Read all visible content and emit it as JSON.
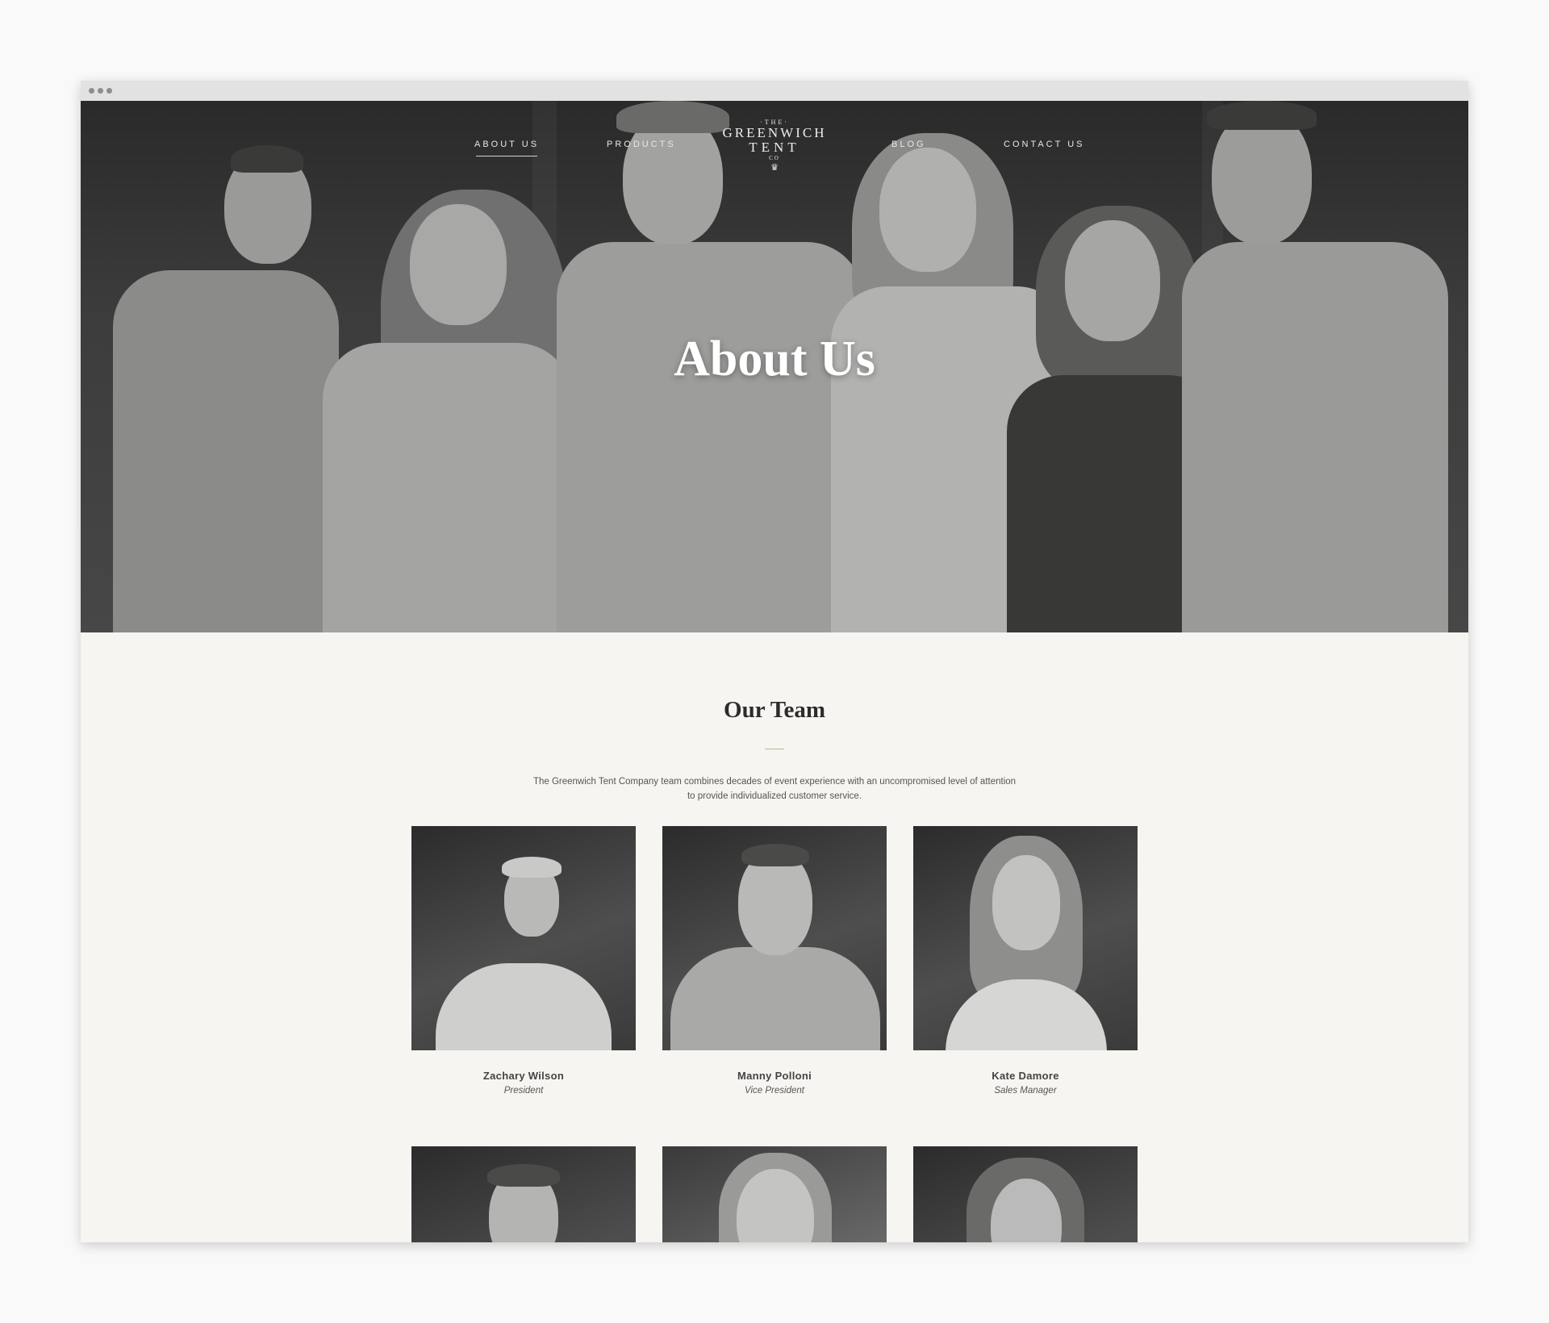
{
  "nav": {
    "left": [
      "ABOUT US",
      "PRODUCTS"
    ],
    "right": [
      "BLOG",
      "CONTACT US"
    ],
    "active": "ABOUT US"
  },
  "logo": {
    "the": "·THE·",
    "line1": "GREENWICH",
    "line2": "TENT",
    "co": "CO",
    "crown": "♛"
  },
  "hero": {
    "title": "About Us"
  },
  "team": {
    "title": "Our Team",
    "description": "The Greenwich Tent Company team combines decades of event experience with an uncompromised level of attention to provide individualized customer service.",
    "members": [
      {
        "name": "Zachary Wilson",
        "role": "President"
      },
      {
        "name": "Manny Polloni",
        "role": "Vice President"
      },
      {
        "name": "Kate Damore",
        "role": "Sales Manager"
      }
    ]
  },
  "colors": {
    "page_bg": "#f6f5f1",
    "accent_rule": "#b8b88a",
    "hero_text": "#ffffff"
  }
}
